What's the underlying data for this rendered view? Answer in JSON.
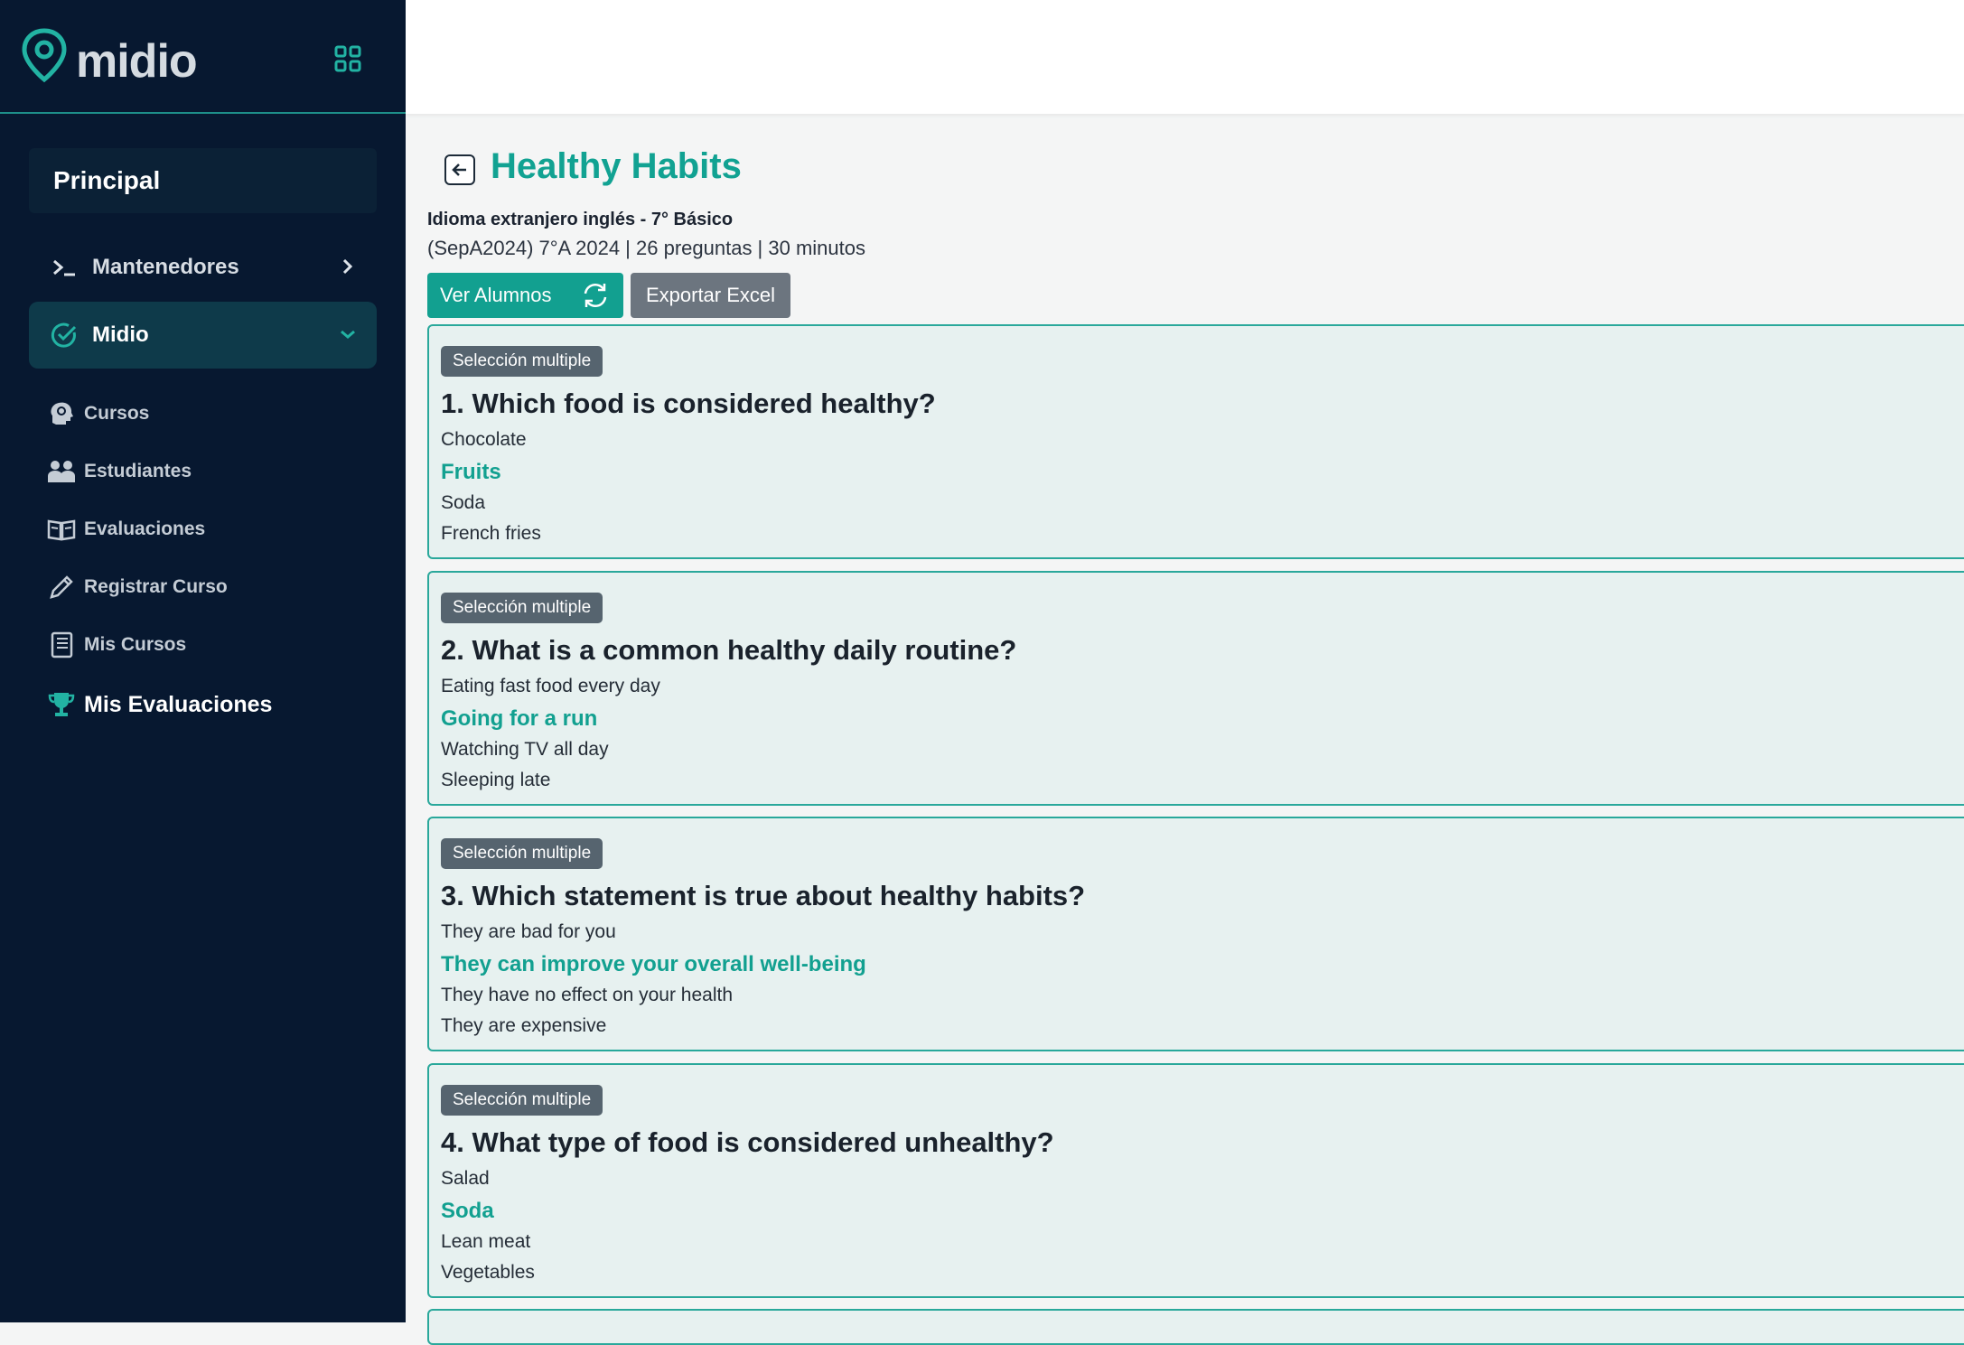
{
  "brand": {
    "name": "midio"
  },
  "sidebar": {
    "principal": "Principal",
    "mantenedores": "Mantenedores",
    "midio": "Midio",
    "items": [
      {
        "label": "Cursos",
        "icon": "brain-icon"
      },
      {
        "label": "Estudiantes",
        "icon": "students-icon"
      },
      {
        "label": "Evaluaciones",
        "icon": "book-icon"
      },
      {
        "label": "Registrar Curso",
        "icon": "pencil-icon"
      },
      {
        "label": "Mis Cursos",
        "icon": "notebook-icon"
      },
      {
        "label": "Mis Evaluaciones",
        "icon": "trophy-icon"
      }
    ]
  },
  "header": {
    "title": "Healthy Habits",
    "subject": "Idioma extranjero inglés - 7° Básico",
    "meta": "(SepA2024) 7°A 2024 | 26 preguntas | 30 minutos"
  },
  "actions": {
    "ver_alumnos": "Ver Alumnos",
    "exportar": "Exportar Excel"
  },
  "questions": [
    {
      "badge": "Selección multiple",
      "title": "1. Which food is considered healthy?",
      "options": [
        "Chocolate",
        "Fruits",
        "Soda",
        "French fries"
      ],
      "correct_index": 1
    },
    {
      "badge": "Selección multiple",
      "title": "2. What is a common healthy daily routine?",
      "options": [
        "Eating fast food every day",
        "Going for a run",
        "Watching TV all day",
        "Sleeping late"
      ],
      "correct_index": 1
    },
    {
      "badge": "Selección multiple",
      "title": "3. Which statement is true about healthy habits?",
      "options": [
        "They are bad for you",
        "They can improve your overall well-being",
        "They have no effect on your health",
        "They are expensive"
      ],
      "correct_index": 1
    },
    {
      "badge": "Selección multiple",
      "title": "4. What type of food is considered unhealthy?",
      "options": [
        "Salad",
        "Soda",
        "Lean meat",
        "Vegetables"
      ],
      "correct_index": 1
    }
  ],
  "colors": {
    "accent": "#12a090",
    "sidebar_bg": "#071830",
    "card_bg": "#e7f1f0",
    "badge_bg": "#56646f"
  }
}
